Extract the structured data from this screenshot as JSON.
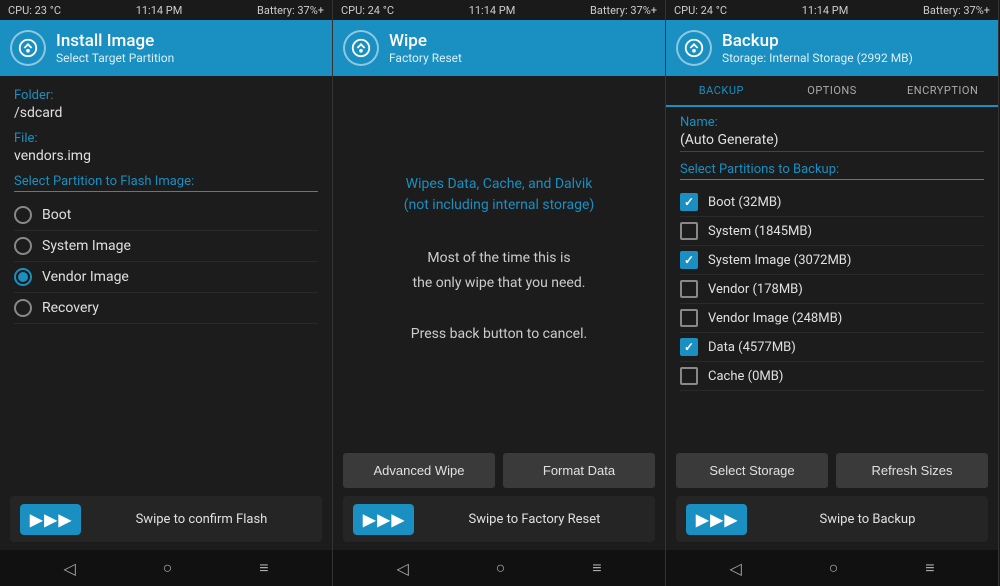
{
  "panel1": {
    "status": {
      "cpu": "CPU: 23 °C",
      "time": "11:14 PM",
      "battery": "Battery: 37%+"
    },
    "title": "Install Image",
    "subtitle": "Select Target Partition",
    "folder_label": "Folder:",
    "folder_value": "/sdcard",
    "file_label": "File:",
    "file_value": "vendors.img",
    "partition_label": "Select Partition to Flash Image:",
    "partitions": [
      {
        "label": "Boot",
        "selected": false
      },
      {
        "label": "System Image",
        "selected": false
      },
      {
        "label": "Vendor Image",
        "selected": true
      },
      {
        "label": "Recovery",
        "selected": false
      }
    ],
    "swipe_label": "Swipe to confirm Flash"
  },
  "panel2": {
    "status": {
      "cpu": "CPU: 24 °C",
      "time": "11:14 PM",
      "battery": "Battery: 37%+"
    },
    "title": "Wipe",
    "subtitle": "Factory Reset",
    "info_text": "Wipes Data, Cache, and Dalvik\n(not including internal storage)",
    "main_text_line1": "Most of the time this is",
    "main_text_line2": "the only wipe that you need.",
    "main_text_line3": "",
    "main_text_line4": "Press back button to cancel.",
    "btn_advanced": "Advanced Wipe",
    "btn_format": "Format Data",
    "swipe_label": "Swipe to Factory Reset"
  },
  "panel3": {
    "status": {
      "cpu": "CPU: 24 °C",
      "time": "11:14 PM",
      "battery": "Battery: 37%+"
    },
    "title": "Backup",
    "subtitle": "Storage: Internal Storage (2992 MB)",
    "tabs": [
      "BACKUP",
      "OPTIONS",
      "ENCRYPTION"
    ],
    "active_tab": 0,
    "name_label": "Name:",
    "name_value": "(Auto Generate)",
    "partitions_label": "Select Partitions to Backup:",
    "partitions": [
      {
        "label": "Boot (32MB)",
        "checked": true
      },
      {
        "label": "System (1845MB)",
        "checked": false
      },
      {
        "label": "System Image (3072MB)",
        "checked": true
      },
      {
        "label": "Vendor (178MB)",
        "checked": false
      },
      {
        "label": "Vendor Image (248MB)",
        "checked": false
      },
      {
        "label": "Data (4577MB)",
        "checked": true
      },
      {
        "label": "Cache (0MB)",
        "checked": false
      }
    ],
    "btn_select_storage": "Select Storage",
    "btn_refresh": "Refresh Sizes",
    "swipe_label": "Swipe to Backup"
  },
  "icons": {
    "logo": "◈",
    "back": "◁",
    "home": "○",
    "menu": "≡"
  }
}
